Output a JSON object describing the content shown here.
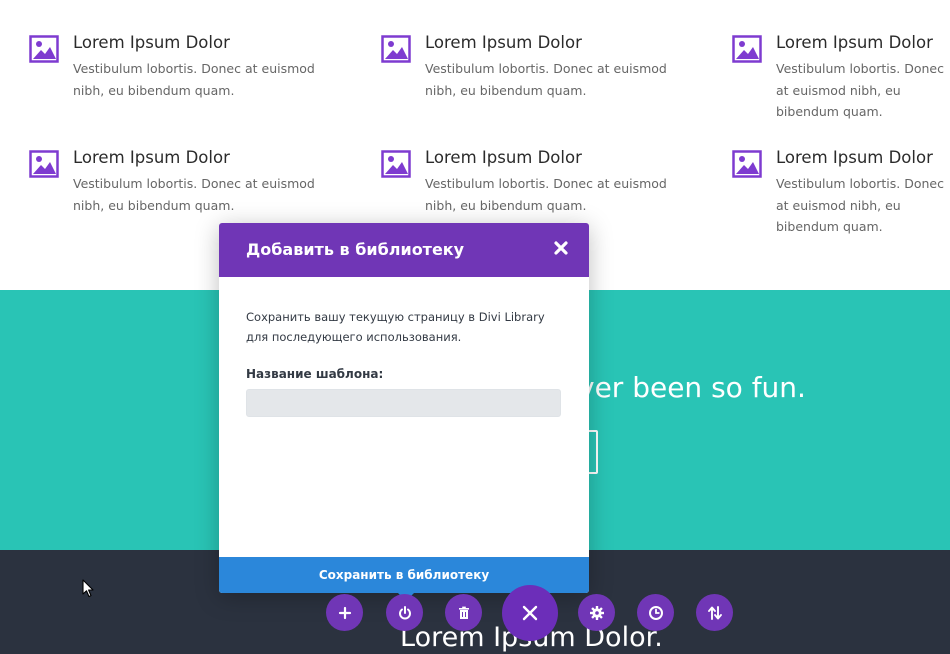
{
  "blurbs": [
    {
      "title": "Lorem Ipsum Dolor",
      "text": "Vestibulum lobortis. Donec at euismod nibh, eu bibendum quam."
    },
    {
      "title": "Lorem Ipsum Dolor",
      "text": "Vestibulum lobortis. Donec at euismod nibh, eu bibendum quam."
    },
    {
      "title": "Lorem Ipsum Dolor",
      "text": "Vestibulum lobortis. Donec at euismod nibh, eu bibendum quam."
    },
    {
      "title": "Lorem Ipsum Dolor",
      "text": "Vestibulum lobortis. Donec at euismod nibh, eu bibendum quam."
    },
    {
      "title": "Lorem Ipsum Dolor",
      "text": "Vestibulum lobortis. Donec at euismod nibh, eu bibendum quam."
    },
    {
      "title": "Lorem Ipsum Dolor",
      "text": "Vestibulum lobortis. Donec at euismod nibh, eu bibendum quam."
    }
  ],
  "teal_section": {
    "headline_visible": "ver been so fun."
  },
  "dark_section": {
    "title": "Lorem Ipsum Dolor."
  },
  "modal": {
    "title": "Добавить в библиотеку",
    "description": "Сохранить вашу текущую страницу в Divi Library для последующего использования.",
    "field_label": "Название шаблона:",
    "field_value": "",
    "field_placeholder": "",
    "save_label": "Сохранить в библиотеку"
  },
  "toolbar": {
    "buttons": [
      {
        "name": "add",
        "icon": "plus-icon"
      },
      {
        "name": "portability",
        "icon": "power-icon"
      },
      {
        "name": "clear",
        "icon": "trash-icon"
      },
      {
        "name": "close",
        "icon": "close-icon"
      },
      {
        "name": "settings",
        "icon": "gear-icon"
      },
      {
        "name": "history",
        "icon": "clock-icon"
      },
      {
        "name": "reorder",
        "icon": "sort-arrows-icon"
      }
    ]
  },
  "colors": {
    "accent_purple": "#7036b6",
    "teal": "#29c4b5",
    "dark": "#2b323f",
    "save_blue": "#2b87da"
  }
}
